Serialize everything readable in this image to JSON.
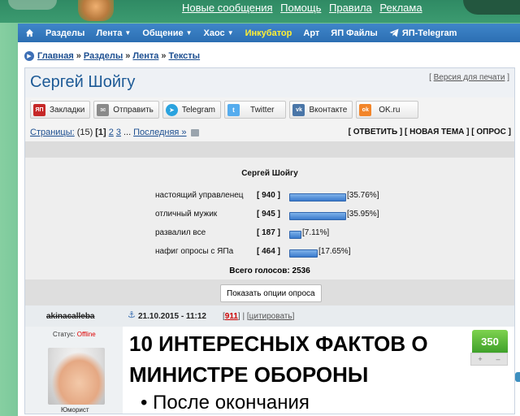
{
  "top_links": [
    "Новые сообщения",
    "Помощь",
    "Правила",
    "Реклама"
  ],
  "nav": [
    {
      "label": "Разделы",
      "dropdown": false
    },
    {
      "label": "Лента",
      "dropdown": true
    },
    {
      "label": "Общение",
      "dropdown": true
    },
    {
      "label": "Хаос",
      "dropdown": true
    },
    {
      "label": "Инкубатор",
      "dropdown": false,
      "highlight": true
    },
    {
      "label": "Арт",
      "dropdown": false
    },
    {
      "label": "ЯП Файлы",
      "dropdown": false
    },
    {
      "label": "ЯП-Telegram",
      "dropdown": false
    }
  ],
  "breadcrumb": [
    "Главная",
    "Разделы",
    "Лента",
    "Тексты"
  ],
  "topic": {
    "title": "Сергей Шойгу",
    "print_link": "Версия для печати"
  },
  "share": [
    {
      "label": "Закладки",
      "icon": "ЯП",
      "color": "#c62828"
    },
    {
      "label": "Отправить",
      "icon": "✉",
      "color": "#8a8a8a"
    },
    {
      "label": "Telegram",
      "icon": "➤",
      "color": "#2aa3df"
    },
    {
      "label": "Twitter",
      "icon": "t",
      "color": "#55acee"
    },
    {
      "label": "Вконтакте",
      "icon": "vk",
      "color": "#4a76a8"
    },
    {
      "label": "OK.ru",
      "icon": "ok",
      "color": "#f2852a"
    }
  ],
  "pagination": {
    "label": "Страницы:",
    "total": "(15)",
    "current": "[1]",
    "pages": [
      "2",
      "3"
    ],
    "ellipsis": "...",
    "last": "Последняя »"
  },
  "actions": "[ ОТВЕТИТЬ ] [ НОВАЯ ТЕМА ] [ ОПРОС ]",
  "chart_data": {
    "type": "bar",
    "title": "Сергей Шойгу",
    "categories": [
      "настоящий управленец",
      "отличный мужик",
      "развалил все",
      "нафиг опросы с ЯПа"
    ],
    "values": [
      940,
      945,
      187,
      464
    ],
    "percent_labels": [
      "[35.76%]",
      "[35.95%]",
      "[7.11%]",
      "[17.65%]"
    ],
    "count_labels": [
      "[ 940 ]",
      "[ 945 ]",
      "[ 187 ]",
      "[ 464 ]"
    ],
    "percent": [
      35.76,
      35.95,
      7.11,
      17.65
    ],
    "total_label": "Всего голосов: 2536"
  },
  "poll_options_button": "Показать опции опроса",
  "post": {
    "author": "akinacalleba",
    "date": "21.10.2015 - 11:12",
    "post_number": "911",
    "quote_link": "цитировать",
    "status_label": "Статус:",
    "status_value": "Offline",
    "rank": "Юморист",
    "heading": "10 ИНТЕРЕСНЫХ ФАКТОВ О МИНИСТРЕ ОБОРОНЫ",
    "bullet_start": "После окончания",
    "score": "350",
    "vote_plus": "+",
    "vote_minus": "–"
  }
}
